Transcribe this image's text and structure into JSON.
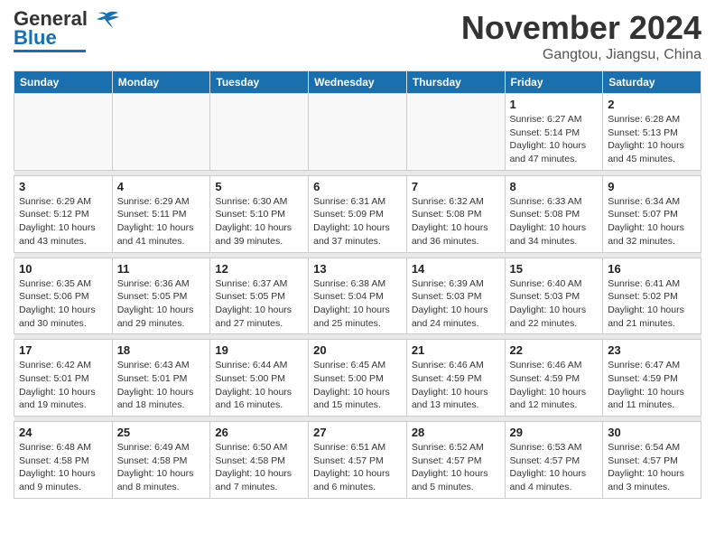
{
  "header": {
    "logo_line1": "General",
    "logo_line2": "Blue",
    "month": "November 2024",
    "location": "Gangtou, Jiangsu, China"
  },
  "weekdays": [
    "Sunday",
    "Monday",
    "Tuesday",
    "Wednesday",
    "Thursday",
    "Friday",
    "Saturday"
  ],
  "weeks": [
    [
      {
        "day": "",
        "info": ""
      },
      {
        "day": "",
        "info": ""
      },
      {
        "day": "",
        "info": ""
      },
      {
        "day": "",
        "info": ""
      },
      {
        "day": "",
        "info": ""
      },
      {
        "day": "1",
        "info": "Sunrise: 6:27 AM\nSunset: 5:14 PM\nDaylight: 10 hours and 47 minutes."
      },
      {
        "day": "2",
        "info": "Sunrise: 6:28 AM\nSunset: 5:13 PM\nDaylight: 10 hours and 45 minutes."
      }
    ],
    [
      {
        "day": "3",
        "info": "Sunrise: 6:29 AM\nSunset: 5:12 PM\nDaylight: 10 hours and 43 minutes."
      },
      {
        "day": "4",
        "info": "Sunrise: 6:29 AM\nSunset: 5:11 PM\nDaylight: 10 hours and 41 minutes."
      },
      {
        "day": "5",
        "info": "Sunrise: 6:30 AM\nSunset: 5:10 PM\nDaylight: 10 hours and 39 minutes."
      },
      {
        "day": "6",
        "info": "Sunrise: 6:31 AM\nSunset: 5:09 PM\nDaylight: 10 hours and 37 minutes."
      },
      {
        "day": "7",
        "info": "Sunrise: 6:32 AM\nSunset: 5:08 PM\nDaylight: 10 hours and 36 minutes."
      },
      {
        "day": "8",
        "info": "Sunrise: 6:33 AM\nSunset: 5:08 PM\nDaylight: 10 hours and 34 minutes."
      },
      {
        "day": "9",
        "info": "Sunrise: 6:34 AM\nSunset: 5:07 PM\nDaylight: 10 hours and 32 minutes."
      }
    ],
    [
      {
        "day": "10",
        "info": "Sunrise: 6:35 AM\nSunset: 5:06 PM\nDaylight: 10 hours and 30 minutes."
      },
      {
        "day": "11",
        "info": "Sunrise: 6:36 AM\nSunset: 5:05 PM\nDaylight: 10 hours and 29 minutes."
      },
      {
        "day": "12",
        "info": "Sunrise: 6:37 AM\nSunset: 5:05 PM\nDaylight: 10 hours and 27 minutes."
      },
      {
        "day": "13",
        "info": "Sunrise: 6:38 AM\nSunset: 5:04 PM\nDaylight: 10 hours and 25 minutes."
      },
      {
        "day": "14",
        "info": "Sunrise: 6:39 AM\nSunset: 5:03 PM\nDaylight: 10 hours and 24 minutes."
      },
      {
        "day": "15",
        "info": "Sunrise: 6:40 AM\nSunset: 5:03 PM\nDaylight: 10 hours and 22 minutes."
      },
      {
        "day": "16",
        "info": "Sunrise: 6:41 AM\nSunset: 5:02 PM\nDaylight: 10 hours and 21 minutes."
      }
    ],
    [
      {
        "day": "17",
        "info": "Sunrise: 6:42 AM\nSunset: 5:01 PM\nDaylight: 10 hours and 19 minutes."
      },
      {
        "day": "18",
        "info": "Sunrise: 6:43 AM\nSunset: 5:01 PM\nDaylight: 10 hours and 18 minutes."
      },
      {
        "day": "19",
        "info": "Sunrise: 6:44 AM\nSunset: 5:00 PM\nDaylight: 10 hours and 16 minutes."
      },
      {
        "day": "20",
        "info": "Sunrise: 6:45 AM\nSunset: 5:00 PM\nDaylight: 10 hours and 15 minutes."
      },
      {
        "day": "21",
        "info": "Sunrise: 6:46 AM\nSunset: 4:59 PM\nDaylight: 10 hours and 13 minutes."
      },
      {
        "day": "22",
        "info": "Sunrise: 6:46 AM\nSunset: 4:59 PM\nDaylight: 10 hours and 12 minutes."
      },
      {
        "day": "23",
        "info": "Sunrise: 6:47 AM\nSunset: 4:59 PM\nDaylight: 10 hours and 11 minutes."
      }
    ],
    [
      {
        "day": "24",
        "info": "Sunrise: 6:48 AM\nSunset: 4:58 PM\nDaylight: 10 hours and 9 minutes."
      },
      {
        "day": "25",
        "info": "Sunrise: 6:49 AM\nSunset: 4:58 PM\nDaylight: 10 hours and 8 minutes."
      },
      {
        "day": "26",
        "info": "Sunrise: 6:50 AM\nSunset: 4:58 PM\nDaylight: 10 hours and 7 minutes."
      },
      {
        "day": "27",
        "info": "Sunrise: 6:51 AM\nSunset: 4:57 PM\nDaylight: 10 hours and 6 minutes."
      },
      {
        "day": "28",
        "info": "Sunrise: 6:52 AM\nSunset: 4:57 PM\nDaylight: 10 hours and 5 minutes."
      },
      {
        "day": "29",
        "info": "Sunrise: 6:53 AM\nSunset: 4:57 PM\nDaylight: 10 hours and 4 minutes."
      },
      {
        "day": "30",
        "info": "Sunrise: 6:54 AM\nSunset: 4:57 PM\nDaylight: 10 hours and 3 minutes."
      }
    ]
  ]
}
